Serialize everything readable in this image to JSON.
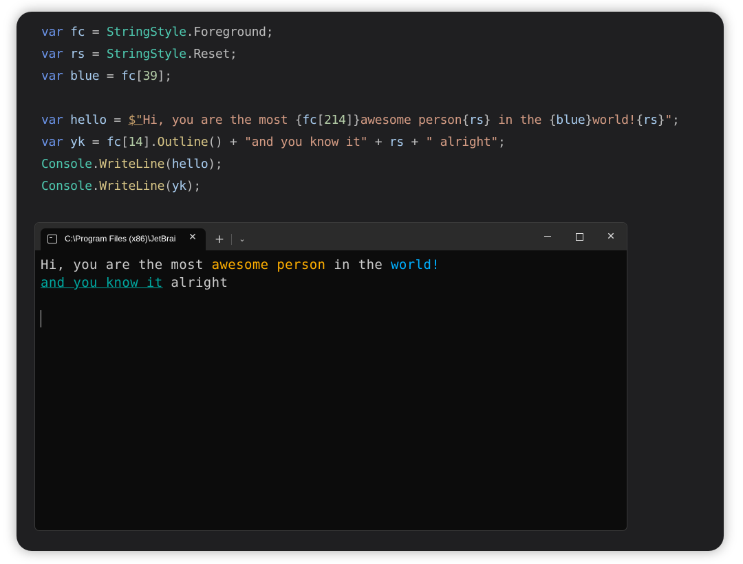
{
  "code": {
    "line1": {
      "kw": "var",
      "name": "fc",
      "eq": " = ",
      "type": "StringStyle",
      "dot": ".",
      "member": "Foreground",
      "end": ";"
    },
    "line2": {
      "kw": "var",
      "name": "rs",
      "eq": " = ",
      "type": "StringStyle",
      "dot": ".",
      "member": "Reset",
      "end": ";"
    },
    "line3": {
      "kw": "var",
      "name": "blue",
      "eq": " = ",
      "fc": "fc",
      "open": "[",
      "num": "39",
      "close": "];"
    },
    "line5": {
      "kw": "var",
      "name": "hello",
      "eq": " = ",
      "prefix": "$\"",
      "s1": "Hi, you are the most ",
      "b1": "{",
      "fc": "fc",
      "lb": "[",
      "num": "214",
      "rb": "]",
      "b2": "}",
      "s2": "awesome person",
      "b3": "{",
      "rs1": "rs",
      "b4": "}",
      "s3": " in the ",
      "b5": "{",
      "blue": "blue",
      "b6": "}",
      "s4": "world!",
      "b7": "{",
      "rs2": "rs",
      "b8": "}",
      "s5": "\"",
      "end": ";"
    },
    "line6": {
      "kw": "var",
      "name": "yk",
      "eq": " = ",
      "fc": "fc",
      "open": "[",
      "num": "14",
      "close": "].",
      "method": "Outline",
      "parens": "()",
      "plus1": " + ",
      "str1": "\"and you know it\"",
      "plus2": " + ",
      "rs": "rs",
      "plus3": " + ",
      "str2": "\" alright\"",
      "end": ";"
    },
    "line7": {
      "type": "Console",
      "dot": ".",
      "method": "WriteLine",
      "open": "(",
      "arg": "hello",
      "close": ");"
    },
    "line8": {
      "type": "Console",
      "dot": ".",
      "method": "WriteLine",
      "open": "(",
      "arg": "yk",
      "close": ");"
    }
  },
  "terminal": {
    "tab_title": "C:\\Program Files (x86)\\JetBrai",
    "tab_close": "✕",
    "new_tab": "+",
    "dropdown": "⌄",
    "close_symbol": "✕",
    "output": {
      "line1": {
        "t1": "Hi, you are the most ",
        "t2": "awesome person",
        "t3": " in the ",
        "t4": "world!"
      },
      "line2": {
        "t1": "and you know it",
        "t2": " alright"
      }
    }
  },
  "colors": {
    "keyword": "#6c95eb",
    "type": "#4ec9b0",
    "string": "#d69d85",
    "orange": "#ffaf00",
    "blue": "#00afff",
    "teal": "#00a8a0"
  },
  "icons": [
    "terminal-icon",
    "close-icon",
    "plus-icon",
    "chevron-down-icon",
    "minimize-icon",
    "maximize-icon"
  ]
}
